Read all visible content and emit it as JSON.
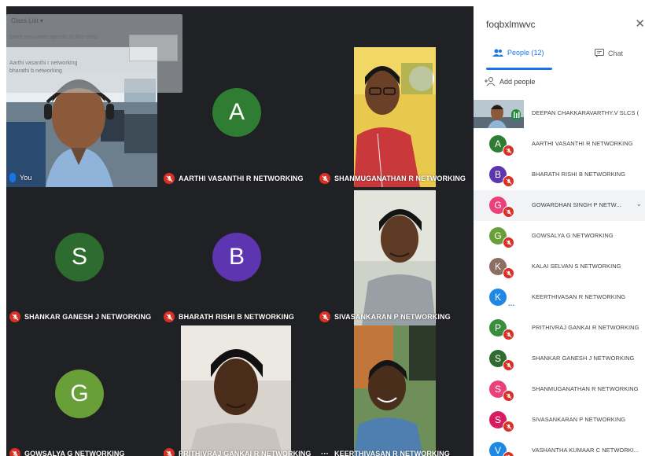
{
  "overlay": {
    "title": "Class List ▾",
    "hint": "Enter any notes specific to this class",
    "lines": [
      "Aarthi vasanthi r networking",
      "bharathi b networking"
    ]
  },
  "tiles": [
    {
      "name": "You"
    },
    {
      "name": "AARTHI VASANTHI R NETWORKING",
      "initial": "A",
      "color": "#2e7d32"
    },
    {
      "name": "SHANMUGANATHAN R NETWORKING"
    },
    {
      "name": "SHANKAR GANESH J NETWORKING",
      "initial": "S",
      "color": "#2e6b2f"
    },
    {
      "name": "BHARATH RISHI B NETWORKING",
      "initial": "B",
      "color": "#5e35b1"
    },
    {
      "name": "SIVASANKARAN P NETWORKING"
    },
    {
      "name": "GOWSALYA G NETWORKING",
      "initial": "G",
      "color": "#689f38"
    },
    {
      "name": "PRITHIVRAJ GANKAI R NETWORKING"
    },
    {
      "name": "KEERTHIVASAN R NETWORKING"
    }
  ],
  "panel": {
    "meeting_code": "foqbxlmwvc",
    "close_icon": "✕",
    "tab_people": "People (12)",
    "tab_chat": "Chat",
    "add_people": "Add people",
    "participants": [
      {
        "name": "DEEPAN CHAKKARAVARTHY.V SLCS (",
        "initial": "",
        "color": "",
        "status": "speaking"
      },
      {
        "name": "AARTHI VASANTHI R NETWORKING",
        "initial": "A",
        "color": "#2e7d32",
        "status": "muted"
      },
      {
        "name": "BHARATH RISHI B NETWORKING",
        "initial": "B",
        "color": "#5e35b1",
        "status": "muted"
      },
      {
        "name": "GOWARDHAN SINGH P NETW...",
        "initial": "G",
        "color": "#ec407a",
        "status": "muted"
      },
      {
        "name": "GOWSALYA G NETWORKING",
        "initial": "G",
        "color": "#689f38",
        "status": "muted"
      },
      {
        "name": "KALAI SELVAN S NETWORKING",
        "initial": "K",
        "color": "#8d6e63",
        "status": "muted"
      },
      {
        "name": "KEERTHIVASAN R NETWORKING",
        "initial": "K",
        "color": "#1e88e5",
        "status": "active"
      },
      {
        "name": "PRITHIVRAJ GANKAI R NETWORKING",
        "initial": "P",
        "color": "#388e3c",
        "status": "muted"
      },
      {
        "name": "SHANKAR GANESH J NETWORKING",
        "initial": "S",
        "color": "#2e6b2f",
        "status": "muted"
      },
      {
        "name": "SHANMUGANATHAN R NETWORKING",
        "initial": "S",
        "color": "#ec407a",
        "status": "muted"
      },
      {
        "name": "SIVASANKARAN P NETWORKING",
        "initial": "S",
        "color": "#d81b60",
        "status": "muted"
      },
      {
        "name": "VASHANTHA KUMAAR C NETWORKI...",
        "initial": "V",
        "color": "#1e88e5",
        "status": "muted"
      }
    ]
  },
  "colors": {
    "accent": "#1a73e8",
    "mute_red": "#d93025",
    "stage_bg": "#202124"
  }
}
